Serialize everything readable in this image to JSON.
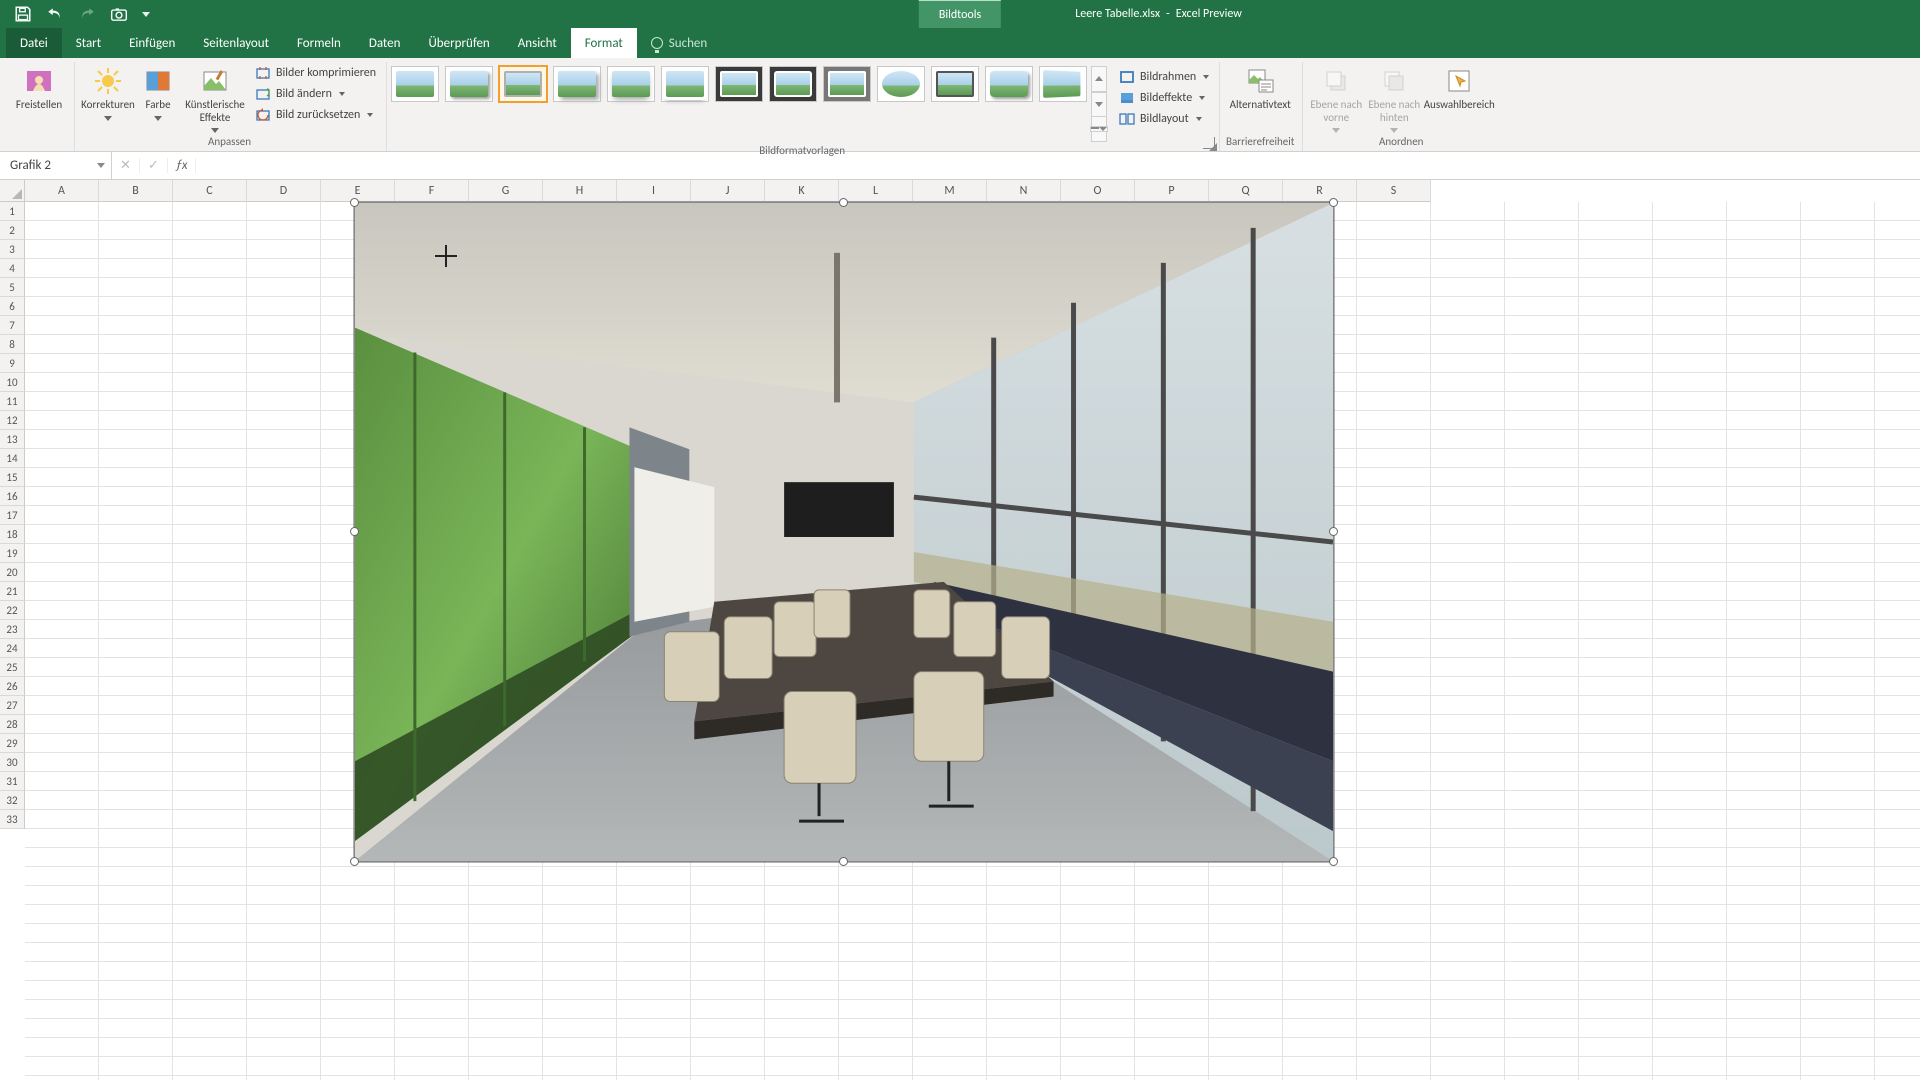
{
  "title": {
    "tool_context": "Bildtools",
    "filename": "Leere Tabelle.xlsx",
    "app": "Excel Preview"
  },
  "tabs": {
    "file": "Datei",
    "home": "Start",
    "insert": "Einfügen",
    "pagelayout": "Seitenlayout",
    "formulas": "Formeln",
    "data": "Daten",
    "review": "Überprüfen",
    "view": "Ansicht",
    "format": "Format",
    "tellme": "Suchen"
  },
  "ribbon": {
    "remove_bg": "Freistellen",
    "corrections": "Korrekturen",
    "color": "Farbe",
    "artistic": "Künstlerische Effekte",
    "compress": "Bilder komprimieren",
    "change": "Bild ändern",
    "reset": "Bild zurücksetzen",
    "adjust_group": "Anpassen",
    "styles_group": "Bildformatvorlagen",
    "border": "Bildrahmen",
    "effects": "Bildeffekte",
    "layout": "Bildlayout",
    "alt_text": "Alternativtext",
    "accessibility_group": "Barrierefreiheit",
    "bring_forward": "Ebene nach vorne",
    "send_backward": "Ebene nach hinten",
    "selection_pane": "Auswahlbereich",
    "arrange_group": "Anordnen"
  },
  "namebox": "Grafik 2",
  "columns": [
    "A",
    "B",
    "C",
    "D",
    "E",
    "F",
    "G",
    "H",
    "I",
    "J",
    "K",
    "L",
    "M",
    "N",
    "O",
    "P",
    "Q",
    "R",
    "S"
  ],
  "rows": [
    "1",
    "2",
    "3",
    "4",
    "5",
    "6",
    "7",
    "8",
    "9",
    "10",
    "11",
    "12",
    "13",
    "14",
    "15",
    "16",
    "17",
    "18",
    "19",
    "20",
    "21",
    "22",
    "23",
    "24",
    "25",
    "26",
    "27",
    "28",
    "29",
    "30",
    "31",
    "32",
    "33"
  ]
}
